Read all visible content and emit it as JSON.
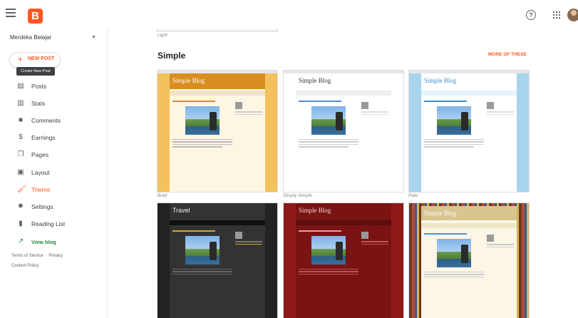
{
  "sidebar": {
    "blog_name": "Merdeka Belajar",
    "new_post_label": "NEW POST",
    "tooltip": "Create New Post",
    "items": [
      {
        "label": "Posts",
        "icon": "posts-icon"
      },
      {
        "label": "Stats",
        "icon": "stats-icon"
      },
      {
        "label": "Comments",
        "icon": "comments-icon"
      },
      {
        "label": "Earnings",
        "icon": "earnings-icon"
      },
      {
        "label": "Pages",
        "icon": "pages-icon"
      },
      {
        "label": "Layout",
        "icon": "layout-icon"
      },
      {
        "label": "Theme",
        "icon": "theme-icon",
        "active": true
      },
      {
        "label": "Settings",
        "icon": "settings-icon"
      },
      {
        "label": "Reading List",
        "icon": "reading-list-icon"
      }
    ],
    "view_blog": "View blog",
    "footer": [
      "Terms of Service",
      "Privacy",
      "Content Policy"
    ]
  },
  "main": {
    "previous_caption": "Light",
    "section_title": "Simple",
    "more_link": "MORE OF THESE",
    "themes": [
      {
        "caption": "Bold",
        "blog_title": "Simple Blog"
      },
      {
        "caption": "Simply Simple",
        "blog_title": "Simple Blog"
      },
      {
        "caption": "Pale",
        "blog_title": "Simple Blog"
      },
      {
        "caption": "",
        "blog_title": "Travel"
      },
      {
        "caption": "",
        "blog_title": "Simple Blog"
      },
      {
        "caption": "",
        "blog_title": "Simple Blog"
      }
    ]
  },
  "colors": {
    "accent": "#ff5722",
    "view_blog": "#1e8e3e"
  }
}
